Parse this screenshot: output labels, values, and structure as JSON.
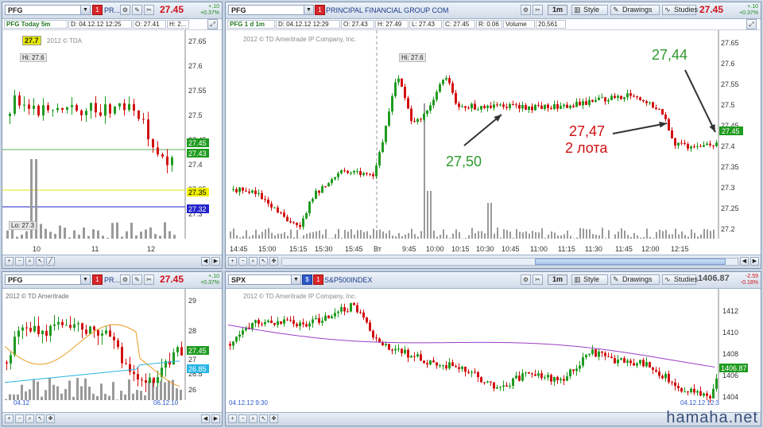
{
  "top_left": {
    "symbol": "PFG",
    "desc": "PR...",
    "price": "27.45",
    "change": "+.10",
    "change_pct": "+0.37%",
    "title": "PFG Today 5m",
    "date": "D: 04.12.12 12:25",
    "open": "O: 27.41",
    "high": "H: 2...",
    "last_tag": "27.7",
    "copyright": "2012 © TDA",
    "hi_label": "Hi: 27.6",
    "lo_label": "Lo: 27.3",
    "axis": [
      "27.65",
      "27.6",
      "27.55",
      "27.5",
      "27.45",
      "27.4",
      "27.35",
      "27.3"
    ],
    "time_axis": [
      "10",
      "11",
      "12"
    ],
    "tags": {
      "last": "27.45",
      "mid": "27.43",
      "yellow": "27.35",
      "blue": "27.32"
    }
  },
  "top_right": {
    "symbol": "PFG",
    "company": "PRINCIPAL FINANCIAL GROUP COM",
    "price": "27.45",
    "change": "+.10",
    "change_pct": "+0.37%",
    "timeframe": "1m",
    "style_label": "Style",
    "drawings_label": "Drawings",
    "studies_label": "Studies",
    "info": {
      "title": "PFG 1 d 1m",
      "date": "D: 04.12.12 12:29",
      "open": "O: 27.43",
      "high": "H: 27.49",
      "low": "L: 27.43",
      "close": "C: 27.45",
      "range": "R: 0.06",
      "volume_label": "Volume",
      "volume": "20,561"
    },
    "copyright": "2012 © TD Ameritrade IP Company, Inc.",
    "hi_label": "Hi: 27.6",
    "axis": [
      "27.65",
      "27.6",
      "27.55",
      "27.5",
      "27.45",
      "27.4",
      "27.35",
      "27.3",
      "27.25",
      "27.2"
    ],
    "time_axis": [
      "14:45",
      "15:00",
      "15:15",
      "15:30",
      "15:45",
      "Вт",
      "9:45",
      "10:00",
      "10:15",
      "10:30",
      "10:45",
      "11:00",
      "11:15",
      "11:30",
      "11:45",
      "12:00",
      "12:15"
    ],
    "last_tag": "27.45",
    "annotations": {
      "a1": "27,50",
      "a2_line1": "27,47",
      "a2_line2": "2 лота",
      "a3": "27,44"
    }
  },
  "bottom_left": {
    "symbol": "PFG",
    "desc": "PR...",
    "price": "27.45",
    "change": "+.10",
    "change_pct": "+0.37%",
    "copyright": "2012 © TD Ameritrade",
    "axis": [
      "29",
      "28",
      "27",
      "26.5",
      "26"
    ],
    "tags": {
      "last": "27.45",
      "ma": "26.85"
    },
    "date_left": "04.12",
    "date_right": "06.12.10"
  },
  "bottom_right": {
    "symbol": "SPX",
    "index_name": "S&P500INDEX",
    "price": "1406.87",
    "change": "-2.59",
    "change_pct": "-0.18%",
    "timeframe": "1m",
    "style_label": "Style",
    "drawings_label": "Drawings",
    "studies_label": "Studies",
    "copyright": "2012 © TD Ameritrade IP Company, Inc.",
    "axis": [
      "1412",
      "1410",
      "1408",
      "1406",
      "1404"
    ],
    "last_tag": "1406.87",
    "date_left": "04.12.12 9:30",
    "date_right": "04.12.12 12:3"
  },
  "watermark": "hamaha.net",
  "colors": {
    "up": "#1f9b1f",
    "down": "#d21010",
    "volume": "#9a9a9a",
    "ma_purple": "#9b3fc4",
    "ma_orange": "#e89b1d",
    "ma_cyan": "#28b4e6",
    "yellow_line": "#e5e500",
    "blue_line": "#2222cc",
    "arrow": "#333333"
  }
}
